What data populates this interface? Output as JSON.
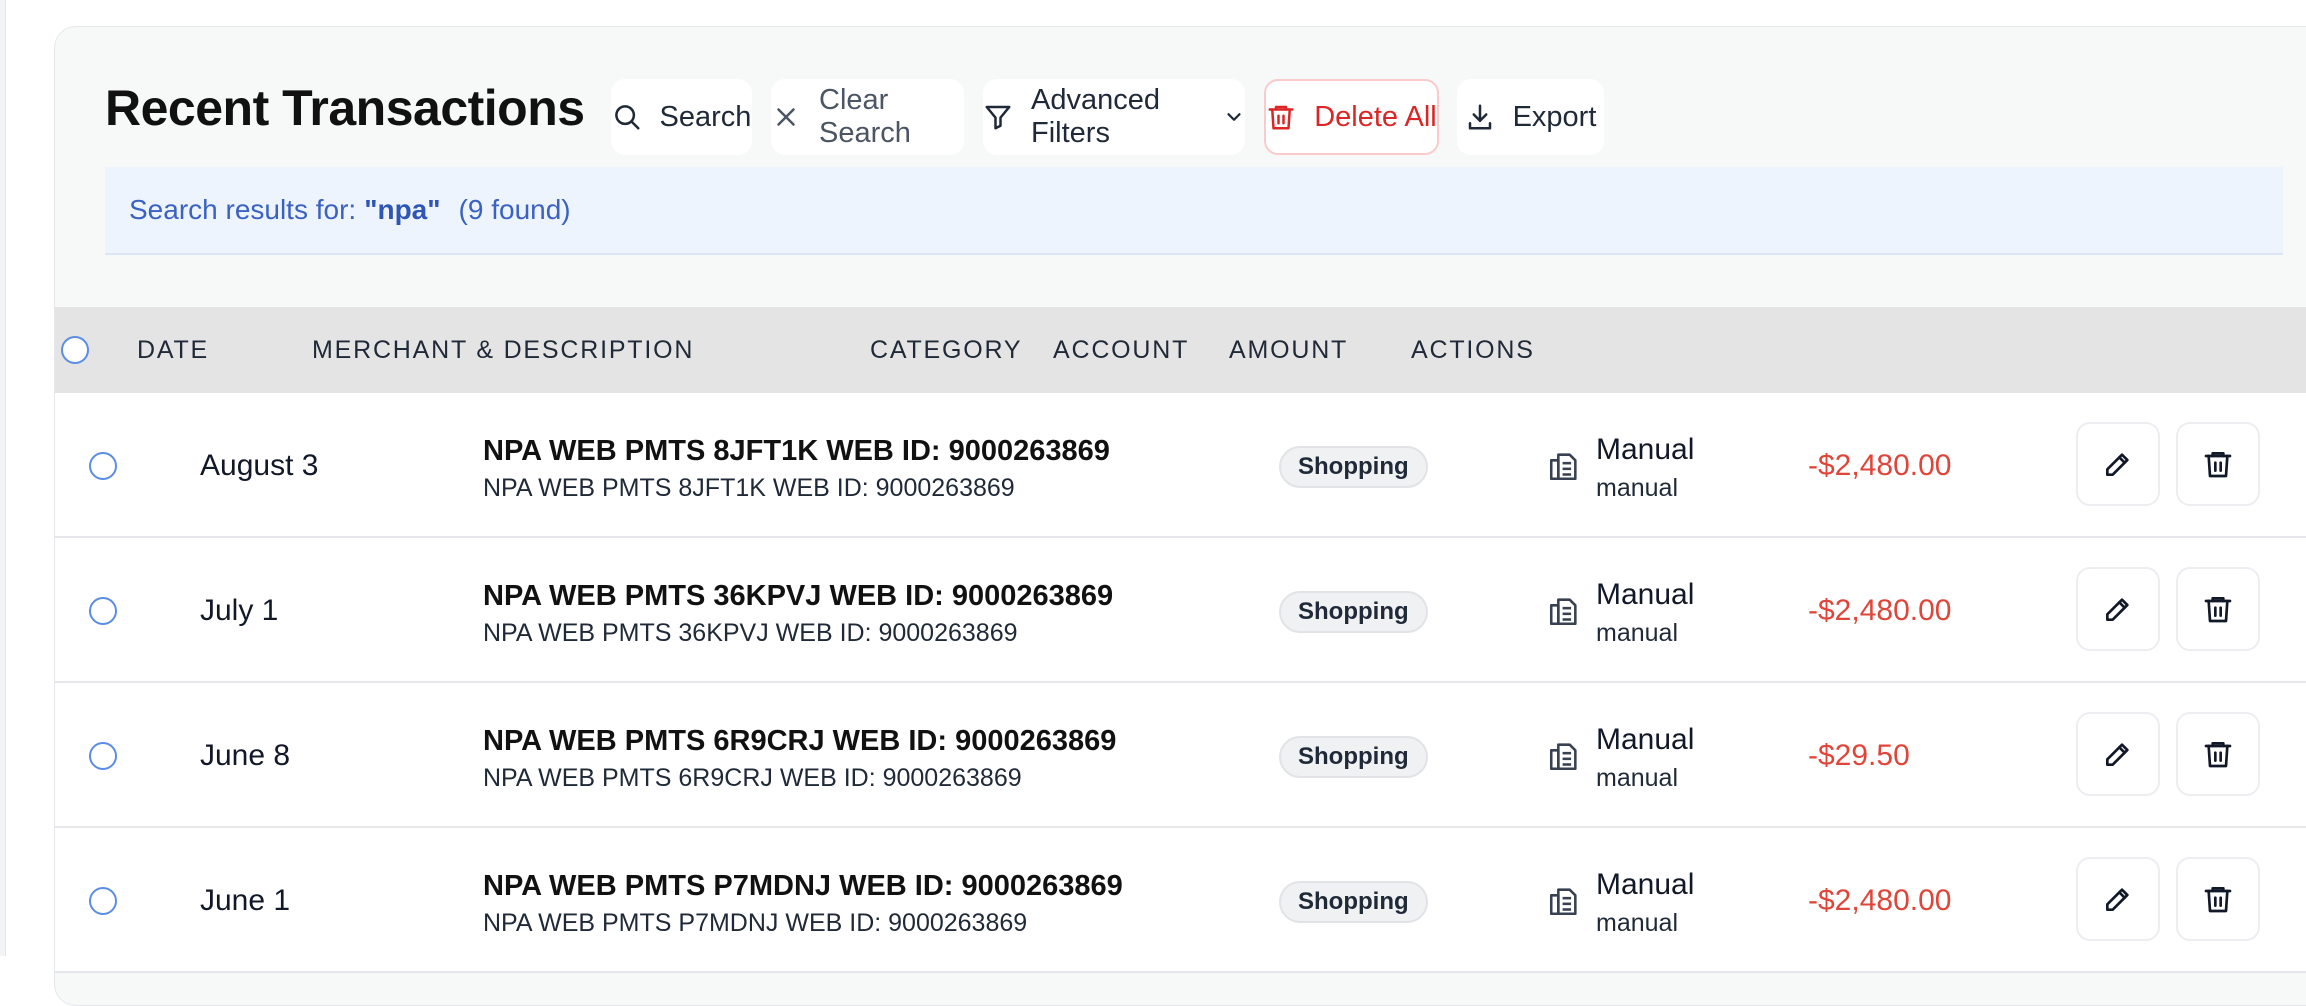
{
  "header": {
    "title": "Recent Transactions",
    "buttons": {
      "search": "Search",
      "clear_search": "Clear Search",
      "advanced_filters": "Advanced Filters",
      "delete_all": "Delete All",
      "export": "Export"
    }
  },
  "search_banner": {
    "prefix": "Search results for:",
    "query": "\"npa\"",
    "count": "(9 found)"
  },
  "table": {
    "columns": {
      "date": "DATE",
      "merchant": "MERCHANT & DESCRIPTION",
      "category": "CATEGORY",
      "account": "ACCOUNT",
      "amount": "AMOUNT",
      "actions": "ACTIONS"
    },
    "rows": [
      {
        "date": "August 3",
        "merchant": "NPA WEB PMTS 8JFT1K WEB ID: 9000263869",
        "description": "NPA WEB PMTS 8JFT1K WEB ID: 9000263869",
        "category": "Shopping",
        "account_name": "Manual",
        "account_type": "manual",
        "amount": "-$2,480.00"
      },
      {
        "date": "July 1",
        "merchant": "NPA WEB PMTS 36KPVJ WEB ID: 9000263869",
        "description": "NPA WEB PMTS 36KPVJ WEB ID: 9000263869",
        "category": "Shopping",
        "account_name": "Manual",
        "account_type": "manual",
        "amount": "-$2,480.00"
      },
      {
        "date": "June 8",
        "merchant": "NPA WEB PMTS 6R9CRJ WEB ID: 9000263869",
        "description": "NPA WEB PMTS 6R9CRJ WEB ID: 9000263869",
        "category": "Shopping",
        "account_name": "Manual",
        "account_type": "manual",
        "amount": "-$29.50"
      },
      {
        "date": "June 1",
        "merchant": "NPA WEB PMTS P7MDNJ WEB ID: 9000263869",
        "description": "NPA WEB PMTS P7MDNJ WEB ID: 9000263869",
        "category": "Shopping",
        "account_name": "Manual",
        "account_type": "manual",
        "amount": "-$2,480.00"
      }
    ]
  },
  "icons": {
    "search": "search-icon",
    "clear": "close-icon",
    "filter": "filter-icon",
    "chevron": "chevron-down-icon",
    "delete": "trash-icon",
    "export": "download-icon",
    "account": "bank-document-icon",
    "edit": "pencil-icon"
  },
  "colors": {
    "danger": "#dc2626",
    "amount_negative": "#e0453a",
    "banner_bg": "#eef4fe",
    "banner_text": "#3b62c0",
    "radio_border": "#5b8de6"
  }
}
